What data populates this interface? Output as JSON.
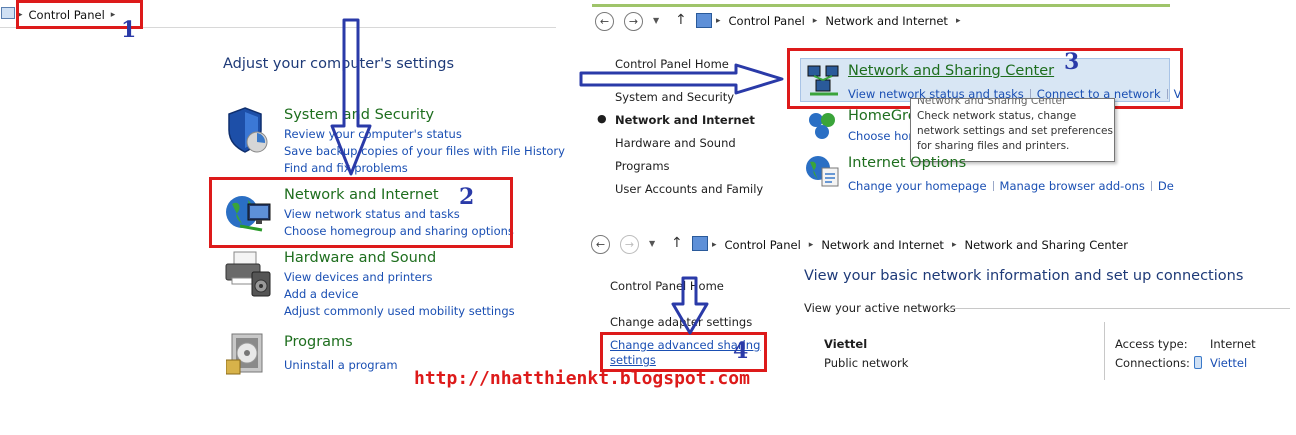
{
  "left_panel": {
    "breadcrumb": "Control Panel",
    "heading": "Adjust your computer's settings",
    "categories": [
      {
        "title": "System and Security",
        "links": [
          "Review your computer's status",
          "Save backup copies of your files with File History",
          "Find and fix problems"
        ]
      },
      {
        "title": "Network and Internet",
        "links": [
          "View network status and tasks",
          "Choose homegroup and sharing options"
        ]
      },
      {
        "title": "Hardware and Sound",
        "links": [
          "View devices and printers",
          "Add a device",
          "Adjust commonly used mobility settings"
        ]
      },
      {
        "title": "Programs",
        "links": [
          "Uninstall a program"
        ]
      }
    ]
  },
  "top_right": {
    "breadcrumb": [
      "Control Panel",
      "Network and Internet"
    ],
    "nav": [
      "Control Panel Home",
      "System and Security",
      "Network and Internet",
      "Hardware and Sound",
      "Programs",
      "User Accounts and Family"
    ],
    "sections": [
      {
        "title": "Network and Sharing Center",
        "links": [
          "View network status and tasks",
          "Connect to a network",
          "V"
        ]
      },
      {
        "title": "HomeGro",
        "links": [
          "Choose hom"
        ]
      },
      {
        "title": "Internet Options",
        "links": [
          "Change your homepage",
          "Manage browser add-ons",
          "De"
        ]
      }
    ],
    "tooltip": {
      "title": "Network and Sharing Center",
      "lines": [
        "Check network status, change",
        "network settings and set preferences",
        "for sharing files and printers."
      ]
    }
  },
  "bottom_right": {
    "breadcrumb": [
      "Control Panel",
      "Network and Internet",
      "Network and Sharing Center"
    ],
    "nav": [
      "Control Panel Home",
      "Change adapter settings",
      "Change advanced sharing",
      "settings"
    ],
    "heading": "View your basic network information and set up connections",
    "subheading": "View your active networks",
    "network_name": "Viettel",
    "network_type": "Public network",
    "access_type_label": "Access type:",
    "access_type_value": "Internet",
    "connections_label": "Connections:",
    "connections_value": "Viettel"
  },
  "annotations": {
    "numbers": [
      "1",
      "2",
      "3",
      "4"
    ],
    "url": "http://nhatthienkt.blogspot.com"
  }
}
